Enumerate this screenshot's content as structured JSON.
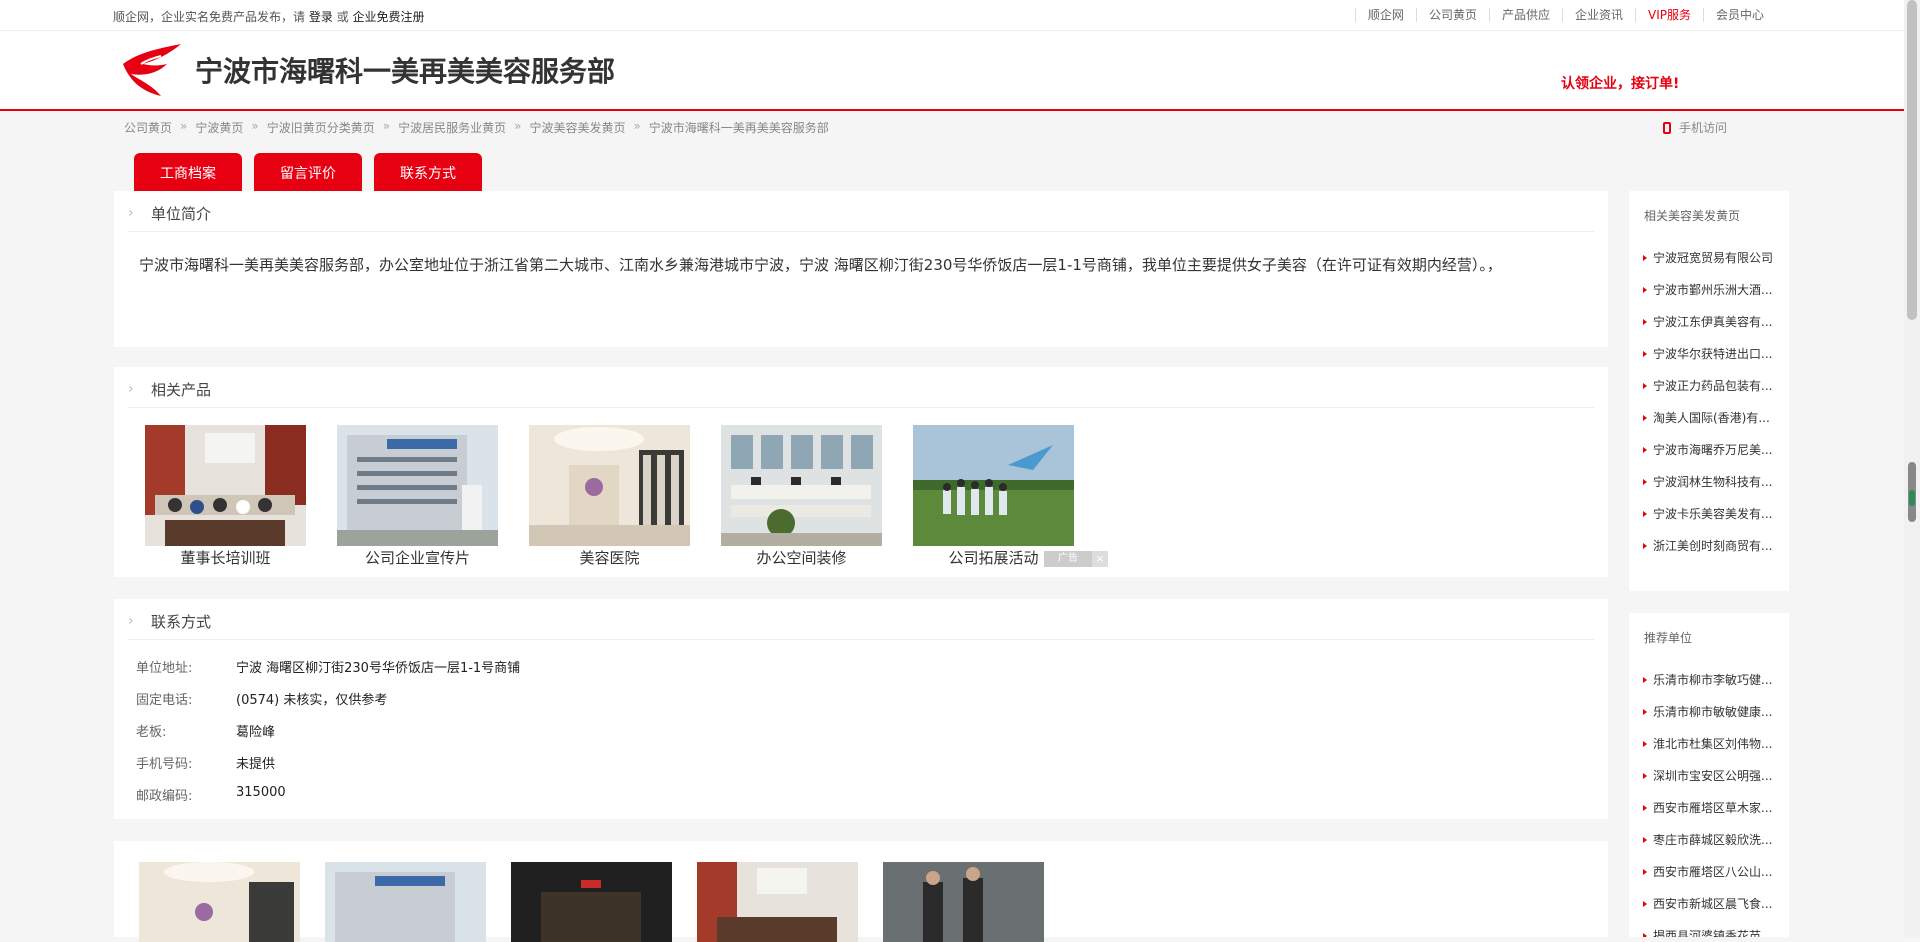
{
  "topbar": {
    "intro": "顺企网，企业实名免费产品发布，请",
    "login": "登录",
    "or": "或",
    "register": "企业免费注册",
    "links": [
      "顺企网",
      "公司黄页",
      "产品供应",
      "企业资讯",
      "VIP服务",
      "会员中心"
    ]
  },
  "header": {
    "title": "宁波市海曙科一美再美美容服务部",
    "claim": "认领企业，接订单!",
    "brand_color": "#e60012"
  },
  "breadcrumb": [
    "公司黄页",
    "宁波黄页",
    "宁波旧黄页分类黄页",
    "宁波居民服务业黄页",
    "宁波美容美发黄页",
    "宁波市海曙科一美再美美容服务部"
  ],
  "breadcrumb_sep": "»",
  "mobile_visit": "手机访问",
  "tabs": [
    "工商档案",
    "留言评价",
    "联系方式"
  ],
  "intro": {
    "title": "单位简介",
    "text": "宁波市海曙科一美再美美容服务部，办公室地址位于浙江省第二大城市、江南水乡兼海港城市宁波，宁波 海曙区柳汀街230号华侨饭店一层1-1号商铺，我单位主要提供女子美容（在许可证有效期内经营）。，"
  },
  "products": {
    "title": "相关产品",
    "items": [
      "董事长培训班",
      "公司企业宣传片",
      "美容医院",
      "办公空间装修",
      "公司拓展活动"
    ],
    "ad_label": "广告",
    "ad_close": "×"
  },
  "contact": {
    "title": "联系方式",
    "rows": [
      {
        "label": "单位地址:",
        "value": "宁波 海曙区柳汀街230号华侨饭店一层1-1号商铺"
      },
      {
        "label": "固定电话:",
        "value": "(0574) 未核实，仅供参考"
      },
      {
        "label": "老板:",
        "value": "葛险峰"
      },
      {
        "label": "手机号码:",
        "value": "未提供"
      },
      {
        "label": "邮政编码:",
        "value": "315000"
      }
    ]
  },
  "sidebar": {
    "related_title": "相关美容美发黄页",
    "related": [
      "宁波冠宽贸易有限公司",
      "宁波市鄞州乐洲大酒...",
      "宁波江东伊真美容有...",
      "宁波华尔获特进出口...",
      "宁波正力药品包装有...",
      "淘美人国际(香港)有...",
      "宁波市海曙乔万尼美...",
      "宁波润林生物科技有...",
      "宁波卡乐美容美发有...",
      "浙江美创时刻商贸有..."
    ],
    "recommend_title": "推荐单位",
    "recommend": [
      "乐清市柳市李敏巧健...",
      "乐清市柳市敏敏健康...",
      "淮北市杜集区刘伟物...",
      "深圳市宝安区公明强...",
      "西安市雁塔区草木家...",
      "枣庄市薛城区毅欣洗...",
      "西安市雁塔区八公山...",
      "西安市新城区晨飞食...",
      "揭西县河婆镇香花苗..."
    ]
  }
}
